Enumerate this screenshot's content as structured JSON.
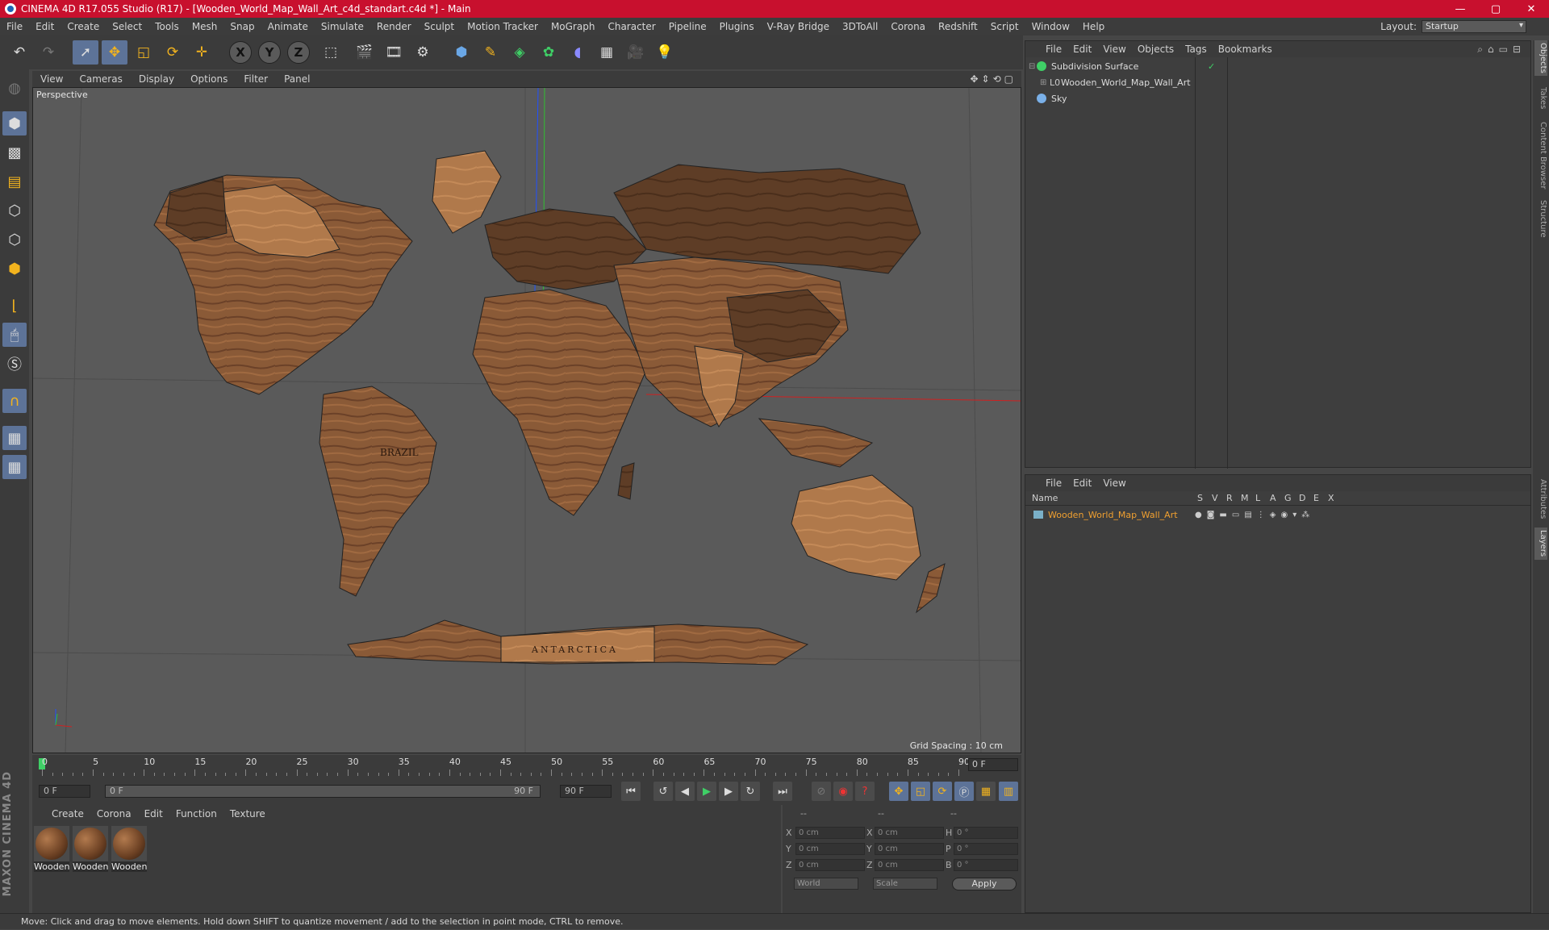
{
  "window": {
    "title": "CINEMA 4D R17.055 Studio (R17) - [Wooden_World_Map_Wall_Art_c4d_standart.c4d *] - Main",
    "minimize": "—",
    "maximize": "▢",
    "close": "✕"
  },
  "menubar": {
    "items": [
      "File",
      "Edit",
      "Create",
      "Select",
      "Tools",
      "Mesh",
      "Snap",
      "Animate",
      "Simulate",
      "Render",
      "Sculpt",
      "Motion Tracker",
      "MoGraph",
      "Character",
      "Pipeline",
      "Plugins",
      "V-Ray Bridge",
      "3DToAll",
      "Corona",
      "Redshift",
      "Script",
      "Window",
      "Help"
    ],
    "layout_label": "Layout:",
    "layout_value": "Startup"
  },
  "toolbar": {
    "x": "X",
    "y": "Y",
    "z": "Z"
  },
  "viewport": {
    "menu": [
      "View",
      "Cameras",
      "Display",
      "Options",
      "Filter",
      "Panel"
    ],
    "label": "Perspective",
    "grid_spacing": "Grid Spacing : 10 cm",
    "map_labels": {
      "brazil": "BRAZIL",
      "antarctica": "ANTARCTICA"
    }
  },
  "timeline": {
    "ticks": [
      "0",
      "5",
      "10",
      "15",
      "20",
      "25",
      "30",
      "35",
      "40",
      "45",
      "50",
      "55",
      "60",
      "65",
      "70",
      "75",
      "80",
      "85",
      "90"
    ],
    "current_frame": "0 F"
  },
  "transport": {
    "start": "0 F",
    "slider_start": "0 F",
    "slider_end": "90 F",
    "end": "90 F"
  },
  "materials": {
    "menu": [
      "Create",
      "Corona",
      "Edit",
      "Function",
      "Texture"
    ],
    "items": [
      "Wooden",
      "Wooden",
      "Wooden"
    ]
  },
  "coords": {
    "headers": [
      "--",
      "--",
      "--"
    ],
    "rows": [
      {
        "a": "X",
        "av": "0 cm",
        "b": "X",
        "bv": "0 cm",
        "c": "H",
        "cv": "0 °"
      },
      {
        "a": "Y",
        "av": "0 cm",
        "b": "Y",
        "bv": "0 cm",
        "c": "P",
        "cv": "0 °"
      },
      {
        "a": "Z",
        "av": "0 cm",
        "b": "Z",
        "bv": "0 cm",
        "c": "B",
        "cv": "0 °"
      }
    ],
    "mode1": "World",
    "mode2": "Scale",
    "apply": "Apply"
  },
  "object_manager": {
    "menu": [
      "File",
      "Edit",
      "View",
      "Objects",
      "Tags",
      "Bookmarks"
    ],
    "objects": [
      "Subdivision Surface",
      "Wooden_World_Map_Wall_Art",
      "Sky"
    ]
  },
  "layer_manager": {
    "menu": [
      "File",
      "Edit",
      "View"
    ],
    "col_name": "Name",
    "cols": [
      "S",
      "V",
      "R",
      "M",
      "L",
      "A",
      "G",
      "D",
      "E",
      "X"
    ],
    "layer": "Wooden_World_Map_Wall_Art",
    "layer_color": "#f0a030"
  },
  "right_tabs": [
    "Objects",
    "Takes",
    "Content Browser",
    "Structure",
    "Attributes",
    "Layers"
  ],
  "status": "Move: Click and drag to move elements. Hold down SHIFT to quantize movement / add to the selection in point mode, CTRL to remove.",
  "brand": "MAXON CINEMA 4D"
}
